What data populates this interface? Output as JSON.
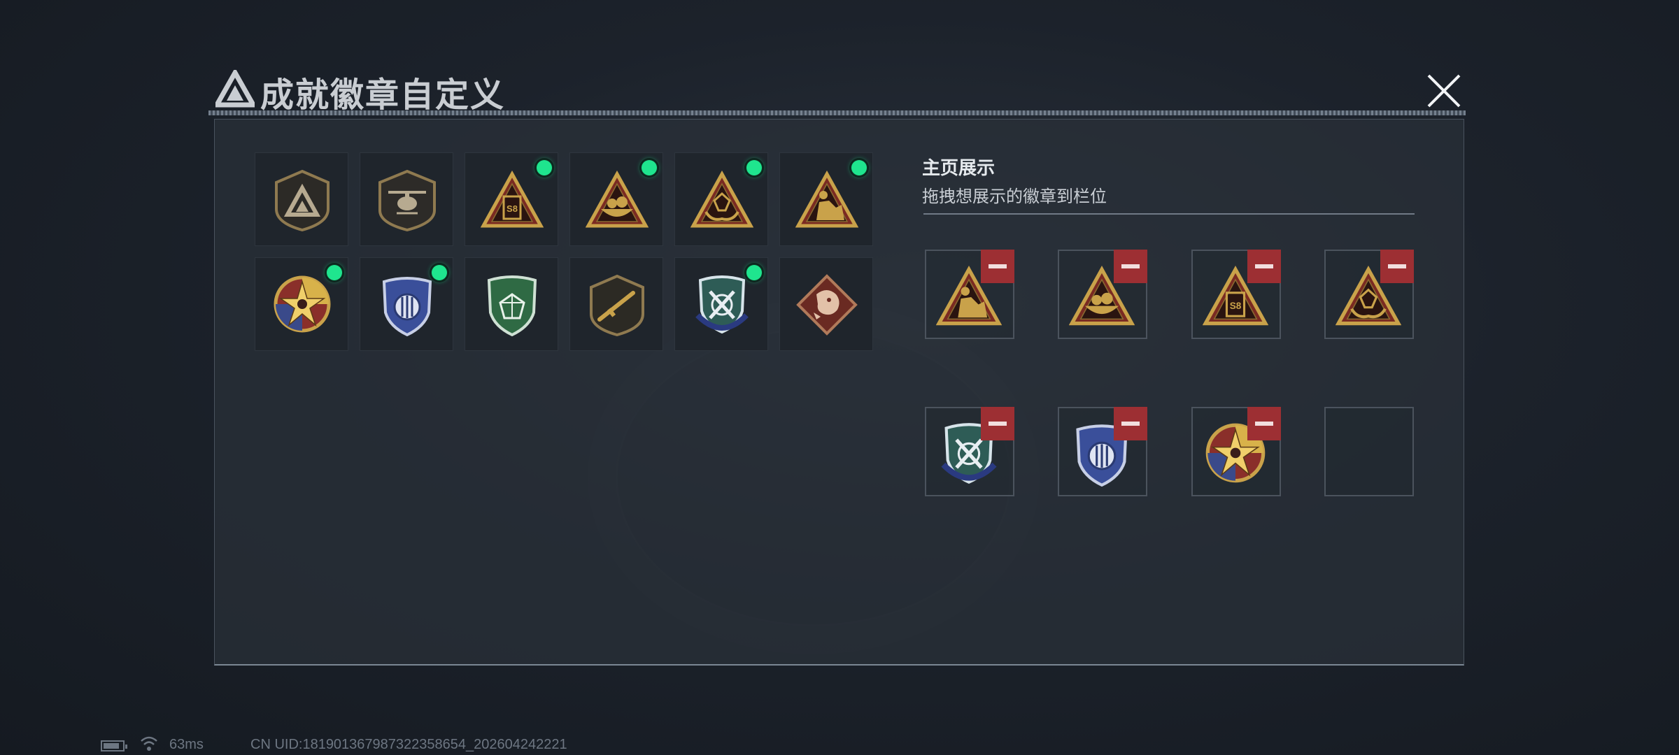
{
  "header": {
    "title": "成就徽章自定义",
    "close_icon": "close-icon"
  },
  "colors": {
    "accent_green": "#1fe58e",
    "remove_red": "#9d2f33",
    "gold": "#c9a24a"
  },
  "badge_grid": {
    "items": [
      {
        "icon": "triangle-logo-badge-icon",
        "equipped": false
      },
      {
        "icon": "helicopter-badge-icon",
        "equipped": false
      },
      {
        "icon": "s8-triangle-badge-icon",
        "equipped": true
      },
      {
        "icon": "bowl-triangle-badge-icon",
        "equipped": true
      },
      {
        "icon": "gem-hands-triangle-badge-icon",
        "equipped": true
      },
      {
        "icon": "soldier-triangle-badge-icon",
        "equipped": true
      },
      {
        "icon": "star-compass-badge-icon",
        "equipped": true
      },
      {
        "icon": "blue-shield-badge-icon",
        "equipped": true
      },
      {
        "icon": "green-gem-shield-badge-icon",
        "equipped": false
      },
      {
        "icon": "rifle-shield-badge-icon",
        "equipped": false
      },
      {
        "icon": "crossed-swords-shield-badge-icon",
        "equipped": true
      },
      {
        "icon": "dragon-diamond-badge-icon",
        "equipped": false
      }
    ]
  },
  "showcase": {
    "title": "主页展示",
    "subtitle": "拖拽想展示的徽章到栏位",
    "slots": [
      {
        "icon": "soldier-triangle-badge-icon",
        "filled": true
      },
      {
        "icon": "bowl-triangle-badge-icon",
        "filled": true
      },
      {
        "icon": "s8-triangle-badge-icon",
        "filled": true
      },
      {
        "icon": "gem-hands-triangle-badge-icon",
        "filled": true
      },
      {
        "icon": "crossed-swords-shield-badge-icon",
        "filled": true
      },
      {
        "icon": "blue-shield-badge-icon",
        "filled": true
      },
      {
        "icon": "star-compass-badge-icon",
        "filled": true
      },
      {
        "icon": "",
        "filled": false
      }
    ]
  },
  "status_bar": {
    "ping": "63ms",
    "uid": "CN UID:18190136798732235865­4_202604242221"
  }
}
